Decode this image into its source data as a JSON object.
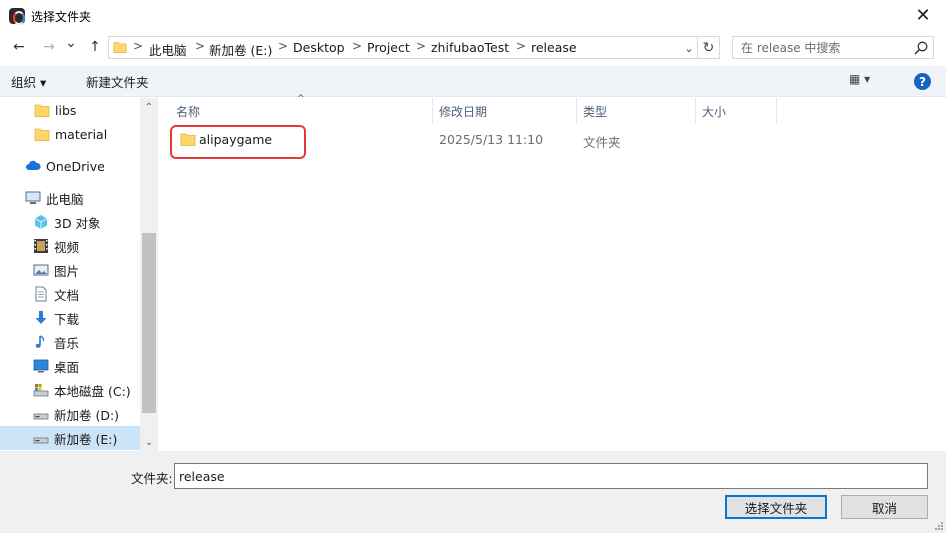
{
  "window": {
    "title": "选择文件夹",
    "close_glyph": "✕"
  },
  "nav_buttons": {
    "back_glyph": "←",
    "forward_glyph": "→",
    "recent_glyph": "⌄",
    "up_glyph": "↑"
  },
  "address": {
    "crumbs": [
      "此电脑",
      "新加卷 (E:)",
      "Desktop",
      "Project",
      "zhifubaoTest",
      "release"
    ],
    "separator": ">",
    "dropdown_glyph": "⌄",
    "refresh_glyph": "↻"
  },
  "search": {
    "placeholder": "在 release 中搜索"
  },
  "toolbar": {
    "organize_label": "组织 ▾",
    "new_folder_label": "新建文件夹",
    "view_label": "▦ ▾",
    "help_label": "?"
  },
  "navpane": {
    "items": [
      {
        "label": "libs",
        "icon": "folder-icon"
      },
      {
        "label": "material",
        "icon": "folder-icon"
      },
      {
        "label": "OneDrive",
        "icon": "cloud-icon"
      },
      {
        "label": "此电脑",
        "icon": "computer-icon"
      },
      {
        "label": "3D 对象",
        "icon": "3d-objects-icon"
      },
      {
        "label": "视频",
        "icon": "video-icon"
      },
      {
        "label": "图片",
        "icon": "pictures-icon"
      },
      {
        "label": "文档",
        "icon": "documents-icon"
      },
      {
        "label": "下载",
        "icon": "download-icon"
      },
      {
        "label": "音乐",
        "icon": "music-icon"
      },
      {
        "label": "桌面",
        "icon": "desktop-icon"
      },
      {
        "label": "本地磁盘 (C:)",
        "icon": "system-drive-icon"
      },
      {
        "label": "新加卷 (D:)",
        "icon": "drive-icon"
      },
      {
        "label": "新加卷 (E:)",
        "icon": "drive-icon"
      }
    ],
    "selected_index": 13,
    "scroll_up_glyph": "⌃",
    "scroll_down_glyph": "⌄"
  },
  "filelist": {
    "columns": [
      "名称",
      "修改日期",
      "类型",
      "大小"
    ],
    "sort_glyph": "^",
    "rows": [
      {
        "name": "alipaygame",
        "modified": "2025/5/13 11:10",
        "type": "文件夹",
        "size": ""
      }
    ]
  },
  "bottom": {
    "folder_label": "文件夹:",
    "folder_value": "release",
    "select_button": "选择文件夹",
    "cancel_button": "取消"
  },
  "colors": {
    "accent": "#0078d7",
    "highlight": "#e53935",
    "selected_bg": "#cce4f7",
    "folder": "#ffd767"
  }
}
